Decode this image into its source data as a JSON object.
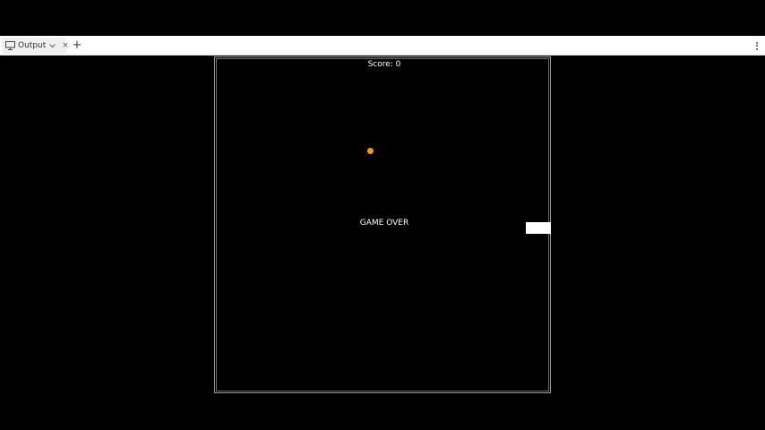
{
  "tabbar": {
    "tab_label": "Output",
    "tab_icon": "monitor-icon",
    "close_label": "×",
    "add_label": "+",
    "more_icon": "vertical-dots-icon"
  },
  "game": {
    "score_text": "Score: 0",
    "status_text": "GAME OVER",
    "ball_color": "#ff9900",
    "paddle_color": "#ffffff",
    "background_color": "#000000"
  }
}
